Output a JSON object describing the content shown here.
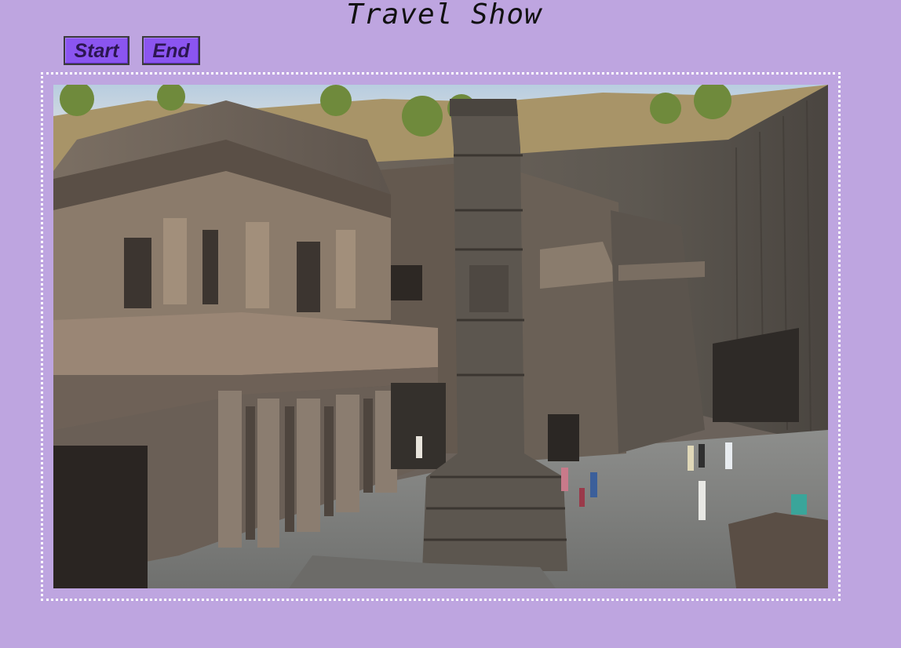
{
  "page": {
    "title": "Travel Show"
  },
  "controls": {
    "start_label": "Start",
    "end_label": "End"
  },
  "slideshow": {
    "current_image_alt": ""
  },
  "colors": {
    "background": "#bea5e0",
    "button_fill": "#8b55f0",
    "frame_border": "#ffffff"
  }
}
